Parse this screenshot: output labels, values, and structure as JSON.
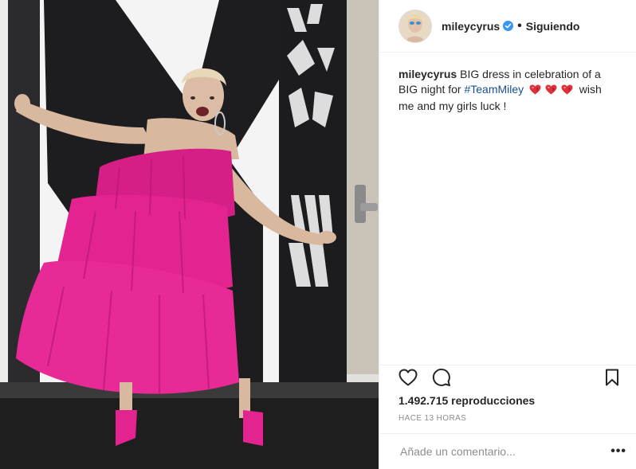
{
  "post": {
    "username": "mileycyrus",
    "follow_status": "Siguiendo",
    "separator": "•",
    "caption": {
      "username": "mileycyrus",
      "text_before": "BIG dress in celebration of a BIG night for ",
      "hashtag": "#TeamMiley",
      "text_after": " wish me and my girls luck !",
      "emoji_icons": [
        "heart-emoji-icon",
        "heart-emoji-icon",
        "heart-emoji-icon"
      ]
    },
    "views": "1.492.715 reproducciones",
    "timestamp": "HACE 13 HORAS",
    "comment_placeholder": "Añade un comentario...",
    "more_label": "•••"
  },
  "colors": {
    "dress": "#e3238f",
    "hashtag": "#1a4f8b",
    "verified": "#3897f0",
    "heart_emoji": "#e0303c",
    "muted": "#8e8e8e"
  }
}
